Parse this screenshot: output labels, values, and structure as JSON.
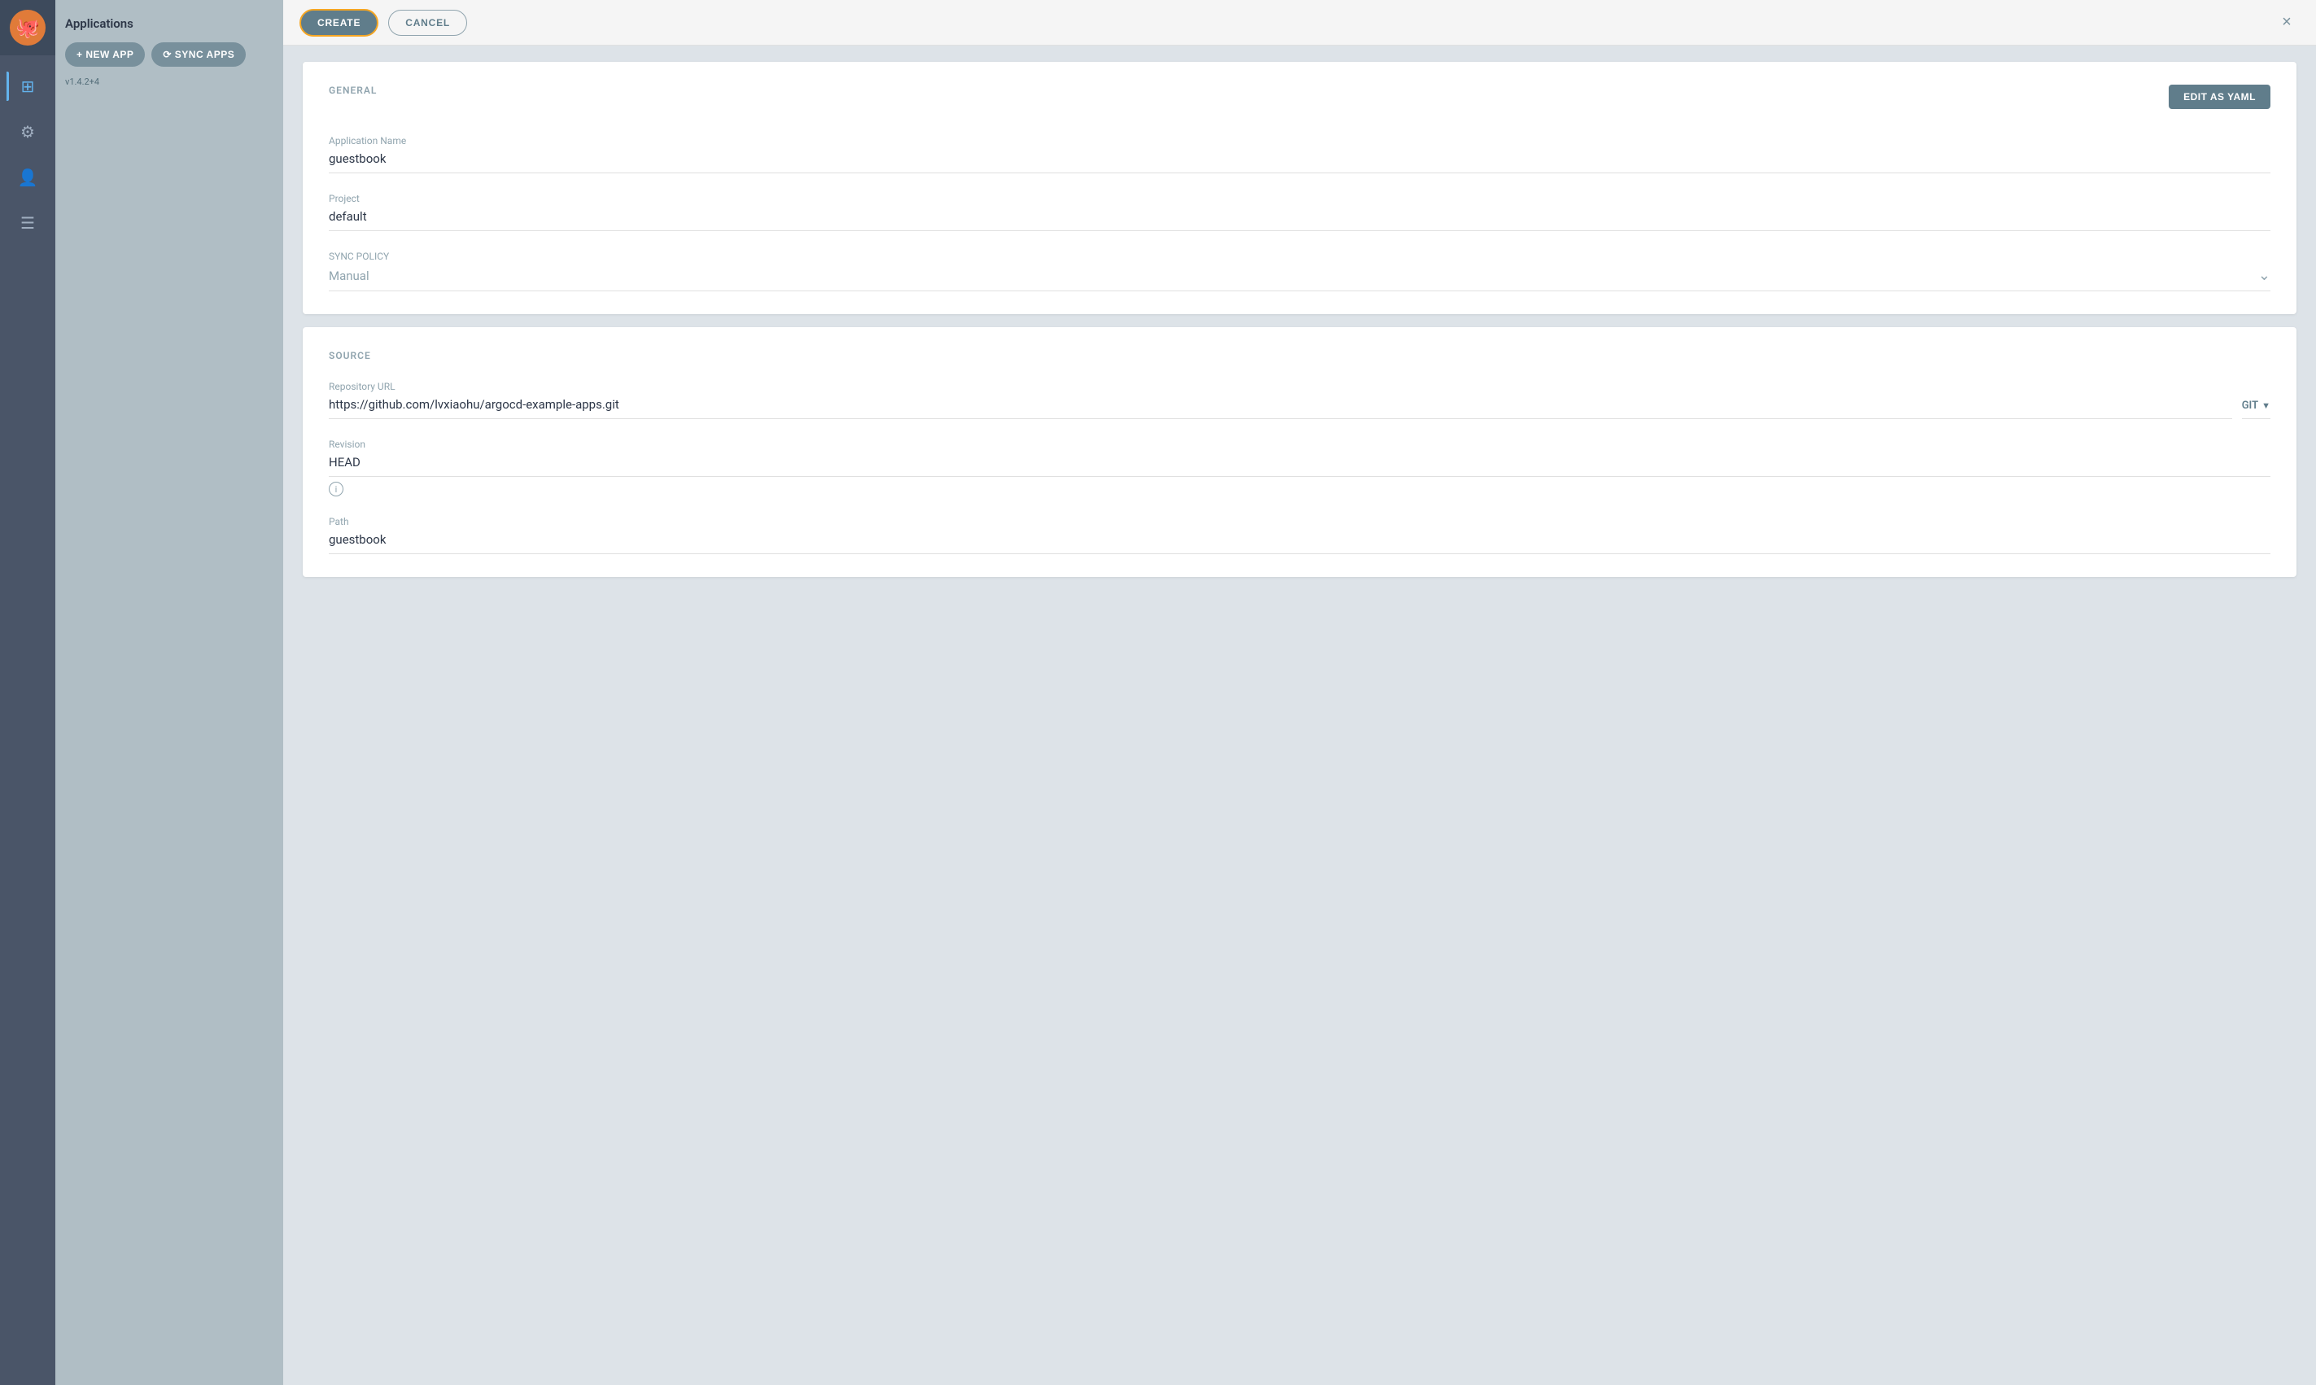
{
  "sidebar": {
    "logo_emoji": "🐙",
    "version": "v1.4.2+4",
    "items": [
      {
        "id": "layers",
        "icon": "⊞",
        "label": "Applications",
        "active": true
      },
      {
        "id": "settings",
        "icon": "⚙",
        "label": "Settings",
        "active": false
      },
      {
        "id": "user",
        "icon": "👤",
        "label": "User",
        "active": false
      },
      {
        "id": "docs",
        "icon": "☰",
        "label": "Docs",
        "active": false
      }
    ]
  },
  "left_panel": {
    "title": "Applications",
    "new_app_label": "+ NEW APP",
    "sync_apps_label": "⟳ SYNC APPS"
  },
  "top_bar": {
    "create_label": "CREATE",
    "cancel_label": "CANCEL",
    "close_label": "×"
  },
  "general_section": {
    "title": "GENERAL",
    "edit_yaml_label": "EDIT AS YAML",
    "app_name_label": "Application Name",
    "app_name_value": "guestbook",
    "project_label": "Project",
    "project_value": "default",
    "sync_policy_label": "SYNC POLICY",
    "sync_policy_value": "Manual"
  },
  "source_section": {
    "title": "SOURCE",
    "repo_url_label": "Repository URL",
    "repo_url_value": "https://github.com/lvxiaohu/argocd-example-apps.git",
    "git_badge": "GIT",
    "revision_label": "Revision",
    "revision_value": "HEAD",
    "path_label": "Path",
    "path_value": "guestbook"
  }
}
